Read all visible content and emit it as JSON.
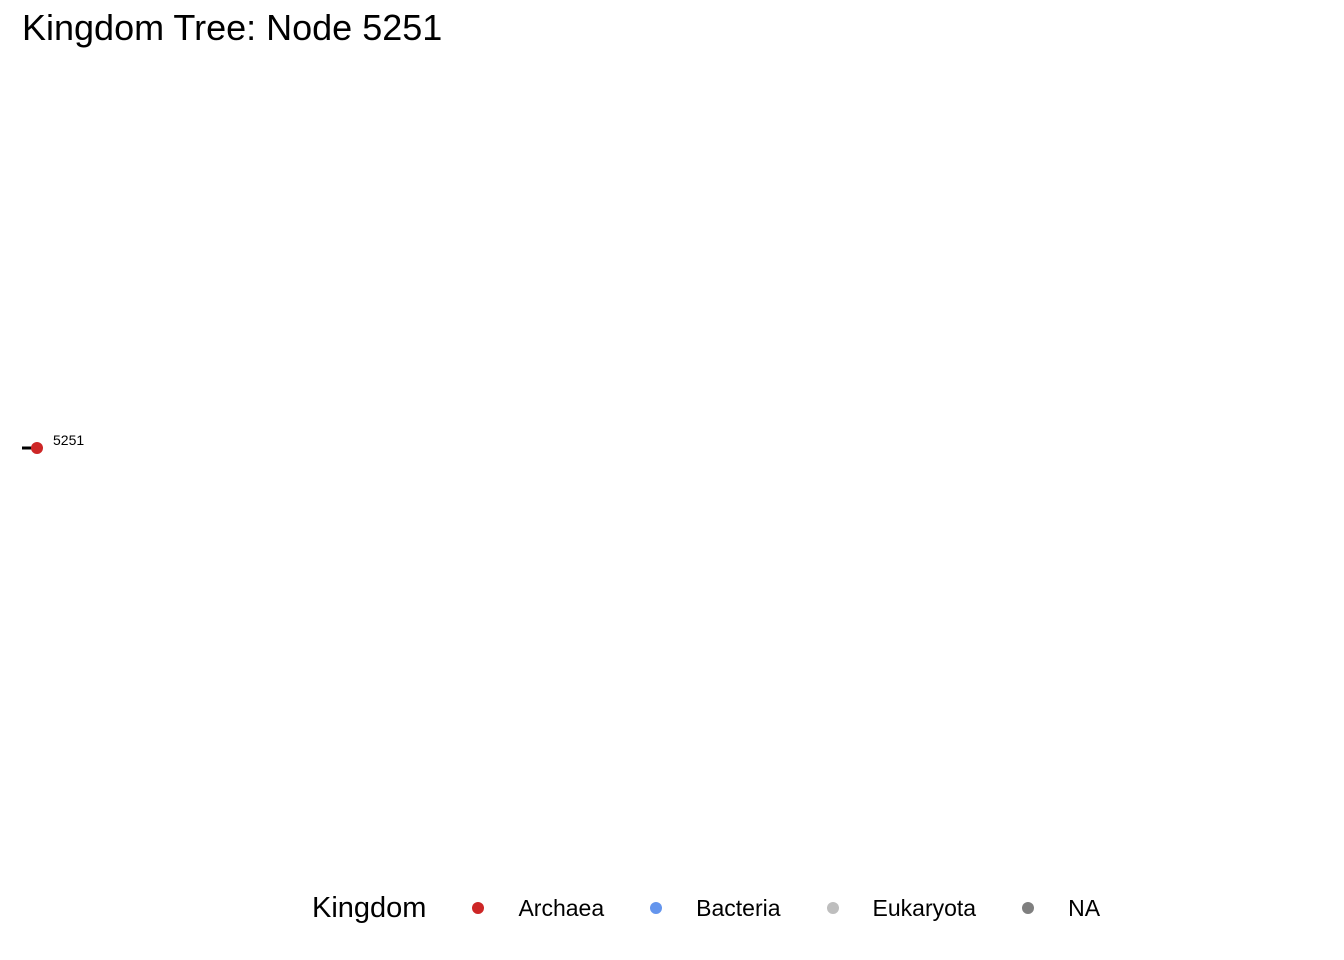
{
  "title": "Kingdom Tree: Node 5251",
  "tree": {
    "nodes": [
      {
        "label": "5251",
        "kingdom": "Archaea"
      }
    ],
    "branch_color": "#000000"
  },
  "legend": {
    "title": "Kingdom",
    "items": [
      {
        "label": "Archaea",
        "color": "#CD2626"
      },
      {
        "label": "Bacteria",
        "color": "#6495ED"
      },
      {
        "label": "Eukaryota",
        "color": "#BEBEBE"
      },
      {
        "label": "NA",
        "color": "#7F7F7F"
      }
    ]
  }
}
